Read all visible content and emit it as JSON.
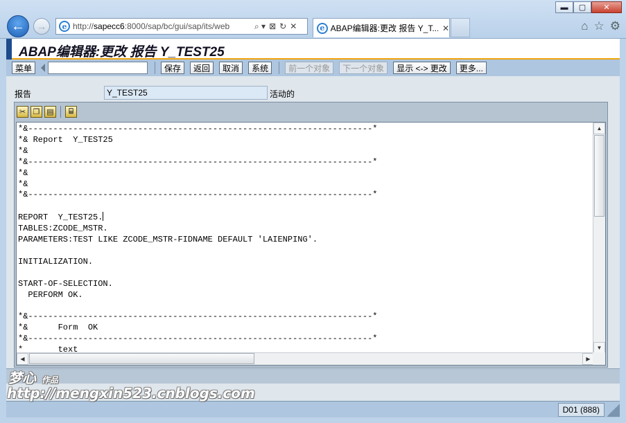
{
  "browser": {
    "window_controls": {
      "minimize": "▬",
      "maximize": "▢",
      "close": "✕"
    },
    "back_icon": "←",
    "forward_icon": "→",
    "address_prefix": "http://",
    "address_host": "sapecc6",
    "address_rest": ":8000/sap/bc/gui/sap/its/web",
    "address_icons": [
      "⌕ ▾",
      "⊠",
      "↻",
      "✕"
    ],
    "tab_title": "ABAP编辑器:更改 报告 Y_T...",
    "tab_close": "✕",
    "right_icons": [
      "⌂",
      "☆",
      "⚙"
    ]
  },
  "sap": {
    "title": "ABAP编辑器:更改  报告  Y_TEST25",
    "toolbar": {
      "menu": "菜单",
      "command_value": "",
      "save": "保存",
      "back": "返回",
      "cancel": "取消",
      "system": "系统",
      "prev_object": "前一个对象",
      "next_object": "下一个对象",
      "toggle_display_change": "显示 <-> 更改",
      "more": "更多..."
    },
    "report_label": "报告",
    "report_value": "Y_TEST25",
    "report_status": "活动的",
    "editor_tools": [
      "cut-icon",
      "copy-icon",
      "paste-icon",
      "find-icon"
    ],
    "code_lines": [
      "*&---------------------------------------------------------------------*",
      "*& Report  Y_TEST25",
      "*&",
      "*&---------------------------------------------------------------------*",
      "*&",
      "*&",
      "*&---------------------------------------------------------------------*",
      "",
      "REPORT  Y_TEST25.",
      "TABLES:ZCODE_MSTR.",
      "PARAMETERS:TEST LIKE ZCODE_MSTR-FIDNAME DEFAULT 'LAIENPING'.",
      "",
      "INITIALIZATION.",
      "",
      "START-OF-SELECTION.",
      "  PERFORM OK.",
      "",
      "*&---------------------------------------------------------------------*",
      "*&      Form  OK",
      "*&---------------------------------------------------------------------*",
      "*       text"
    ],
    "status_system": "D01 (888)"
  },
  "watermark": {
    "line1": "梦心",
    "line1_small": "作品",
    "line2": "http://mengxin523.cnblogs.com"
  }
}
